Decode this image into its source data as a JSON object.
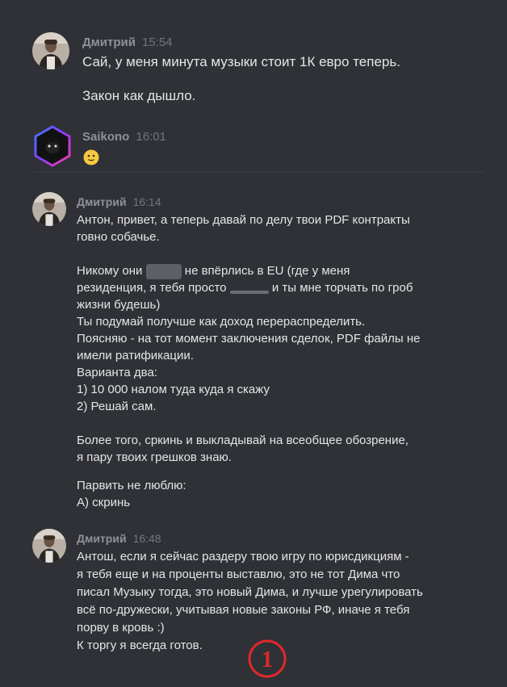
{
  "messages": [
    {
      "author": "Дмитрий",
      "time": "15:54",
      "lines": [
        "Сай, у меня минута музыки стоит 1К евро теперь.",
        "Закон как дышло."
      ]
    },
    {
      "author": "Saikono",
      "time": "16:01",
      "emoji": "slightly-smiling-face"
    },
    {
      "author": "Дмитрий",
      "time": "16:14",
      "lines": [
        "Антон, привет, а теперь давай по делу твои PDF контракты",
        "говно собачье.",
        "Никому они",
        "не впёрлись в EU (где у меня",
        "резиденция, я тебя просто",
        "и ты мне торчать по гроб",
        "жизни будешь)",
        "Ты подумай получше как доход перераспределить.",
        "Поясняю - на тот момент заключения сделок, PDF файлы не",
        "имели ратификации.",
        "Варианта два:",
        "1) 10 000 налом туда куда я скажу",
        "2) Решай сам.",
        "Более того, сркинь и выкладывай на всеобщее обозрение,",
        "я пару твоих грешков знаю.",
        "Парвить не люблю:",
        "А) скринь"
      ]
    },
    {
      "author": "Дмитрий",
      "time": "16:48",
      "lines": [
        "Антош, если я сейчас раздеру твою игру по юрисдикциям -",
        "я тебя еще и на проценты выставлю, это не тот Дима что",
        "писал Музыку тогда, это новый Дима, и лучше урегулировать",
        "всё по-дружески, учитывая новые законы РФ, иначе я тебя",
        "порву в кровь :)",
        "К торгу я всегда готов."
      ]
    }
  ],
  "annotation": {
    "label": "1",
    "color": "#e0282a"
  },
  "colors": {
    "background": "#2f3136",
    "author": "#8e9297",
    "timestamp": "#72767d",
    "text": "#e4e5e7"
  }
}
